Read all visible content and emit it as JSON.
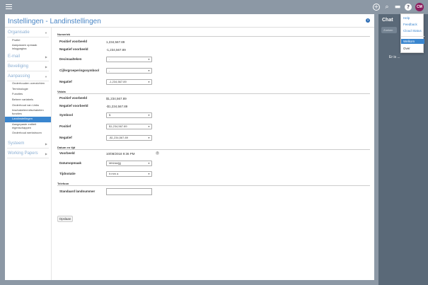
{
  "page": {
    "title": "Instellingen - Landinstellingen"
  },
  "sidebar": {
    "sections": [
      {
        "label": "Organisatie",
        "items": [
          "Profiel",
          "Aanpassen opmaak inlogpagina"
        ]
      },
      {
        "label": "E-mail",
        "items": []
      },
      {
        "label": "Beveiliging",
        "items": []
      },
      {
        "label": "Aanpassing",
        "items": [
          "Onderhouden overzichten",
          "Terminologie",
          "Functies",
          "Beheer variabels",
          "Onderhoud van Links",
          "Inschakelen/uitschakelen functies",
          "Landinstellingen",
          "Aangepaste entiteit eigenschappen",
          "Onderhoud werkstroom"
        ]
      },
      {
        "label": "Systeem",
        "items": []
      },
      {
        "label": "Working Papers",
        "items": []
      }
    ],
    "active_item": "Landinstellingen"
  },
  "numeriek": {
    "heading": "Numeriek",
    "positief_label": "Positief voorbeeld",
    "positief_value": "1,234,567.89",
    "negatief_label": "Negatief voorbeeld",
    "negatief_value": "-1,234,567.89",
    "decimaal_label": "Decimaalteken",
    "decimaal_value": ".",
    "cijfer_label": "Cijfergroeperingssymbool",
    "cijfer_value": ",",
    "neg_label": "Negatief",
    "neg_value": "-1,234,567.89"
  },
  "valuta": {
    "heading": "Valuta",
    "positief_label": "Positief voorbeeld",
    "positief_value": "$1,234,567.89",
    "negatief_label": "Negatief voorbeeld",
    "negatief_value": "-$1,234,567.89",
    "symbool_label": "Symbool",
    "symbool_value": "$",
    "pos_label": "Positief",
    "pos_value": "$1,234,567.89",
    "neg_label": "Negatief",
    "neg_value": "-$1,234,567.89"
  },
  "datum": {
    "heading": "Datum en tijd",
    "voorbeeld_label": "Voorbeeld",
    "voorbeeld_value": "10/08/2018 9:36 PM",
    "help_glyph": "?",
    "datumopmaak_label": "Datumopmaak",
    "datumopmaak_value": "MM/dd/jjjj",
    "tijd_label": "Tijdnotatie",
    "tijd_value": "h:mm a"
  },
  "telefoon": {
    "heading": "Telefoon",
    "landnummer_label": "Standaard landnummer",
    "landnummer_value": ""
  },
  "save_label": "Opslaan",
  "chat": {
    "title": "Chat",
    "search_placeholder": "Zoeken",
    "text": "Er is ..."
  },
  "topbar": {
    "avatar_initials": "CM",
    "icons": [
      "menu-icon",
      "add-icon",
      "search-icon",
      "chat-icon",
      "help-icon"
    ]
  },
  "help_menu": {
    "items": [
      "Help",
      "Feedback",
      "Cloud Status",
      "Welkom",
      "Over"
    ],
    "selected": "Welkom"
  }
}
